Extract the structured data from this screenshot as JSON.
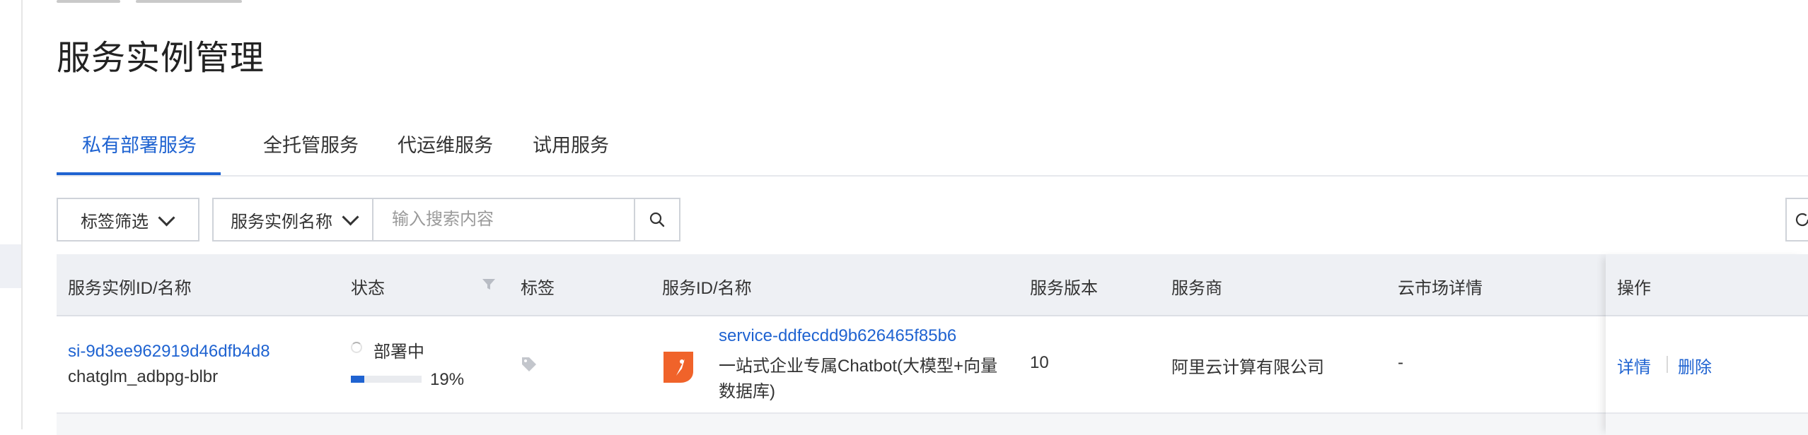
{
  "page": {
    "title": "服务实例管理"
  },
  "tabs": [
    {
      "label": "私有部署服务",
      "active": true
    },
    {
      "label": "全托管服务",
      "active": false
    },
    {
      "label": "代运维服务",
      "active": false
    },
    {
      "label": "试用服务",
      "active": false
    }
  ],
  "filters": {
    "tag_filter_label": "标签筛选",
    "search_field_label": "服务实例名称",
    "search_placeholder": "输入搜索内容"
  },
  "table": {
    "columns": [
      "服务实例ID/名称",
      "状态",
      "标签",
      "服务ID/名称",
      "服务版本",
      "服务商",
      "云市场详情",
      "操作"
    ],
    "rows": [
      {
        "instance_id": "si-9d3ee962919d46dfb4d8",
        "instance_name": "chatglm_adbpg-blbr",
        "status": "部署中",
        "progress_percent": 19,
        "progress_text": "19%",
        "service_id": "service-ddfecdd9b626465f85b6",
        "service_name_line1": "一站式企业专属Chatbot(大模型+向量",
        "service_name_line2": "数据库)",
        "version": "10",
        "provider": "阿里云计算有限公司",
        "market_detail": "-",
        "actions": {
          "detail": "详情",
          "delete": "删除"
        }
      }
    ]
  },
  "colors": {
    "accent": "#1f63d1",
    "logo": "#f0632a"
  },
  "icons": [
    "search-icon",
    "chevron-down-icon",
    "tag-icon",
    "filter-icon",
    "loading-spinner-icon",
    "service-logo-icon"
  ]
}
